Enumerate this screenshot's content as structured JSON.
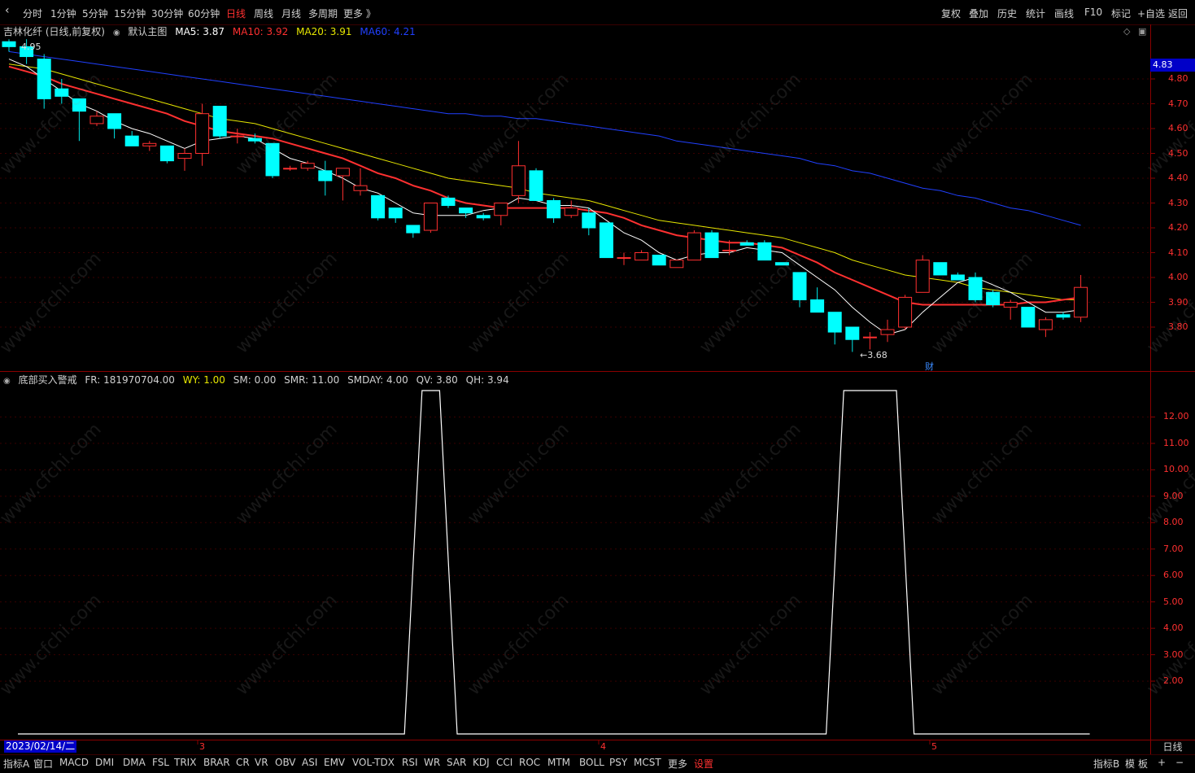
{
  "toolbar": {
    "back_arrow": "‹",
    "periods": [
      "分时",
      "1分钟",
      "5分钟",
      "15分钟",
      "30分钟",
      "60分钟",
      "日线",
      "周线",
      "月线",
      "多周期",
      "更多 》"
    ],
    "active_period": "日线",
    "right_items": [
      "复权",
      "叠加",
      "历史",
      "统计",
      "画线",
      "F10",
      "标记",
      "+自选",
      "返回"
    ]
  },
  "main_header": {
    "stock": "吉林化纤 (日线,前复权)",
    "template_icon": "dot-icon",
    "template": "默认主图",
    "ma5": "MA5: 3.87",
    "ma10": "MA10: 3.92",
    "ma20": "MA20: 3.91",
    "ma60": "MA60: 4.21",
    "colors": {
      "ma5": "#ffffff",
      "ma10": "#ff3030",
      "ma20": "#e6e600",
      "ma60": "#2040ff"
    }
  },
  "price_axis": {
    "labels": [
      "4.80",
      "4.70",
      "4.60",
      "4.50",
      "4.40",
      "4.30",
      "4.20",
      "4.10",
      "4.00",
      "3.90",
      "3.80"
    ],
    "current_price": "4.83"
  },
  "annotations": {
    "high": "4.95",
    "low": "←3.68",
    "fin_marker": "财"
  },
  "indicator_header": {
    "name": "底部买入警戒",
    "fr": "FR: 181970704.00",
    "wy": "WY: 1.00",
    "sm": "SM: 0.00",
    "smr": "SMR: 11.00",
    "smday": "SMDAY: 4.00",
    "qv": "QV: 3.80",
    "qh": "QH: 3.94"
  },
  "indicator_axis": {
    "labels": [
      "12.00",
      "11.00",
      "10.00",
      "9.00",
      "8.00",
      "7.00",
      "6.00",
      "5.00",
      "4.00",
      "3.00",
      "2.00"
    ]
  },
  "date_axis": {
    "current": "2023/02/14/二",
    "ticks": [
      "3",
      "4",
      "5"
    ],
    "period": "日线"
  },
  "bottom_tabs": [
    "指标A",
    "窗口",
    "MACD",
    "DMI",
    "DMA",
    "FSL",
    "TRIX",
    "BRAR",
    "CR",
    "VR",
    "OBV",
    "ASI",
    "EMV",
    "VOL-TDX",
    "RSI",
    "WR",
    "SAR",
    "KDJ",
    "CCI",
    "ROC",
    "MTM",
    "BOLL",
    "PSY",
    "MCST",
    "更多",
    "设置"
  ],
  "bottom_right": [
    "指标B",
    "模",
    "板",
    "+",
    "−"
  ],
  "watermark": "www.cfchi.com",
  "candles": [
    {
      "o": 4.95,
      "h": 4.96,
      "l": 4.91,
      "c": 4.93
    },
    {
      "o": 4.93,
      "h": 4.96,
      "l": 4.86,
      "c": 4.89
    },
    {
      "o": 4.88,
      "h": 4.9,
      "l": 4.68,
      "c": 4.72
    },
    {
      "o": 4.76,
      "h": 4.8,
      "l": 4.7,
      "c": 4.73
    },
    {
      "o": 4.72,
      "h": 4.72,
      "l": 4.55,
      "c": 4.67
    },
    {
      "o": 4.62,
      "h": 4.67,
      "l": 4.61,
      "c": 4.65
    },
    {
      "o": 4.66,
      "h": 4.66,
      "l": 4.56,
      "c": 4.6
    },
    {
      "o": 4.57,
      "h": 4.59,
      "l": 4.53,
      "c": 4.53
    },
    {
      "o": 4.53,
      "h": 4.55,
      "l": 4.51,
      "c": 4.54
    },
    {
      "o": 4.53,
      "h": 4.53,
      "l": 4.46,
      "c": 4.47
    },
    {
      "o": 4.48,
      "h": 4.52,
      "l": 4.43,
      "c": 4.5
    },
    {
      "o": 4.5,
      "h": 4.7,
      "l": 4.45,
      "c": 4.66
    },
    {
      "o": 4.69,
      "h": 4.69,
      "l": 4.56,
      "c": 4.57
    },
    {
      "o": 4.57,
      "h": 4.6,
      "l": 4.54,
      "c": 4.57
    },
    {
      "o": 4.56,
      "h": 4.58,
      "l": 4.54,
      "c": 4.55
    },
    {
      "o": 4.54,
      "h": 4.54,
      "l": 4.4,
      "c": 4.41
    },
    {
      "o": 4.44,
      "h": 4.45,
      "l": 4.43,
      "c": 4.44
    },
    {
      "o": 4.44,
      "h": 4.47,
      "l": 4.43,
      "c": 4.46
    },
    {
      "o": 4.43,
      "h": 4.47,
      "l": 4.33,
      "c": 4.39
    },
    {
      "o": 4.41,
      "h": 4.44,
      "l": 4.31,
      "c": 4.44
    },
    {
      "o": 4.35,
      "h": 4.44,
      "l": 4.33,
      "c": 4.37
    },
    {
      "o": 4.33,
      "h": 4.33,
      "l": 4.23,
      "c": 4.24
    },
    {
      "o": 4.28,
      "h": 4.28,
      "l": 4.22,
      "c": 4.24
    },
    {
      "o": 4.21,
      "h": 4.21,
      "l": 4.16,
      "c": 4.18
    },
    {
      "o": 4.19,
      "h": 4.3,
      "l": 4.18,
      "c": 4.3
    },
    {
      "o": 4.32,
      "h": 4.33,
      "l": 4.28,
      "c": 4.29
    },
    {
      "o": 4.28,
      "h": 4.28,
      "l": 4.24,
      "c": 4.26
    },
    {
      "o": 4.25,
      "h": 4.26,
      "l": 4.23,
      "c": 4.24
    },
    {
      "o": 4.25,
      "h": 4.3,
      "l": 4.21,
      "c": 4.3
    },
    {
      "o": 4.33,
      "h": 4.55,
      "l": 4.3,
      "c": 4.45
    },
    {
      "o": 4.43,
      "h": 4.44,
      "l": 4.31,
      "c": 4.31
    },
    {
      "o": 4.31,
      "h": 4.32,
      "l": 4.22,
      "c": 4.24
    },
    {
      "o": 4.25,
      "h": 4.31,
      "l": 4.24,
      "c": 4.28
    },
    {
      "o": 4.26,
      "h": 4.28,
      "l": 4.17,
      "c": 4.2
    },
    {
      "o": 4.22,
      "h": 4.22,
      "l": 4.08,
      "c": 4.08
    },
    {
      "o": 4.08,
      "h": 4.1,
      "l": 4.05,
      "c": 4.08
    },
    {
      "o": 4.07,
      "h": 4.11,
      "l": 4.07,
      "c": 4.1
    },
    {
      "o": 4.09,
      "h": 4.09,
      "l": 4.05,
      "c": 4.05
    },
    {
      "o": 4.04,
      "h": 4.07,
      "l": 4.04,
      "c": 4.07
    },
    {
      "o": 4.07,
      "h": 4.19,
      "l": 4.07,
      "c": 4.18
    },
    {
      "o": 4.18,
      "h": 4.19,
      "l": 4.08,
      "c": 4.08
    },
    {
      "o": 4.11,
      "h": 4.15,
      "l": 4.09,
      "c": 4.11
    },
    {
      "o": 4.14,
      "h": 4.15,
      "l": 4.13,
      "c": 4.13
    },
    {
      "o": 4.14,
      "h": 4.15,
      "l": 4.07,
      "c": 4.07
    },
    {
      "o": 4.06,
      "h": 4.06,
      "l": 4.05,
      "c": 4.05
    },
    {
      "o": 4.02,
      "h": 4.02,
      "l": 3.88,
      "c": 3.91
    },
    {
      "o": 3.91,
      "h": 3.96,
      "l": 3.86,
      "c": 3.86
    },
    {
      "o": 3.86,
      "h": 3.86,
      "l": 3.73,
      "c": 3.78
    },
    {
      "o": 3.8,
      "h": 3.8,
      "l": 3.7,
      "c": 3.75
    },
    {
      "o": 3.76,
      "h": 3.78,
      "l": 3.71,
      "c": 3.76
    },
    {
      "o": 3.77,
      "h": 3.83,
      "l": 3.74,
      "c": 3.79
    },
    {
      "o": 3.8,
      "h": 3.93,
      "l": 3.79,
      "c": 3.92
    },
    {
      "o": 3.94,
      "h": 4.09,
      "l": 3.94,
      "c": 4.07
    },
    {
      "o": 4.06,
      "h": 4.06,
      "l": 4.01,
      "c": 4.01
    },
    {
      "o": 4.01,
      "h": 4.02,
      "l": 3.99,
      "c": 3.99
    },
    {
      "o": 4.0,
      "h": 4.02,
      "l": 3.9,
      "c": 3.91
    },
    {
      "o": 3.94,
      "h": 3.95,
      "l": 3.88,
      "c": 3.89
    },
    {
      "o": 3.88,
      "h": 3.91,
      "l": 3.83,
      "c": 3.9
    },
    {
      "o": 3.88,
      "h": 3.88,
      "l": 3.8,
      "c": 3.8
    },
    {
      "o": 3.79,
      "h": 3.84,
      "l": 3.76,
      "c": 3.83
    },
    {
      "o": 3.85,
      "h": 3.86,
      "l": 3.83,
      "c": 3.84
    },
    {
      "o": 3.84,
      "h": 4.01,
      "l": 3.82,
      "c": 3.96
    }
  ],
  "ma_series": {
    "ma5": [
      4.88,
      4.85,
      4.8,
      4.75,
      4.7,
      4.67,
      4.63,
      4.6,
      4.58,
      4.55,
      4.52,
      4.55,
      4.56,
      4.57,
      4.56,
      4.52,
      4.48,
      4.46,
      4.43,
      4.4,
      4.36,
      4.34,
      4.3,
      4.26,
      4.25,
      4.25,
      4.25,
      4.27,
      4.28,
      4.32,
      4.31,
      4.29,
      4.29,
      4.28,
      4.23,
      4.18,
      4.15,
      4.1,
      4.07,
      4.09,
      4.1,
      4.1,
      4.12,
      4.11,
      4.1,
      4.05,
      4.0,
      3.95,
      3.88,
      3.82,
      3.77,
      3.79,
      3.86,
      3.92,
      3.98,
      4.0,
      3.97,
      3.94,
      3.9,
      3.86,
      3.86,
      3.87
    ],
    "ma10": [
      4.85,
      4.83,
      4.81,
      4.78,
      4.76,
      4.74,
      4.72,
      4.7,
      4.68,
      4.66,
      4.63,
      4.61,
      4.59,
      4.58,
      4.57,
      4.56,
      4.54,
      4.52,
      4.5,
      4.48,
      4.45,
      4.42,
      4.4,
      4.37,
      4.35,
      4.32,
      4.3,
      4.29,
      4.28,
      4.28,
      4.28,
      4.28,
      4.28,
      4.27,
      4.26,
      4.24,
      4.21,
      4.19,
      4.17,
      4.16,
      4.15,
      4.14,
      4.14,
      4.13,
      4.12,
      4.09,
      4.06,
      4.02,
      3.99,
      3.96,
      3.93,
      3.9,
      3.89,
      3.89,
      3.89,
      3.89,
      3.89,
      3.89,
      3.9,
      3.9,
      3.91,
      3.92
    ],
    "ma20": [
      4.86,
      4.85,
      4.84,
      4.82,
      4.8,
      4.78,
      4.76,
      4.74,
      4.72,
      4.7,
      4.68,
      4.66,
      4.64,
      4.63,
      4.62,
      4.6,
      4.58,
      4.56,
      4.54,
      4.52,
      4.5,
      4.48,
      4.46,
      4.44,
      4.42,
      4.4,
      4.39,
      4.38,
      4.37,
      4.36,
      4.34,
      4.33,
      4.32,
      4.31,
      4.29,
      4.27,
      4.25,
      4.23,
      4.22,
      4.21,
      4.2,
      4.19,
      4.18,
      4.17,
      4.16,
      4.14,
      4.12,
      4.1,
      4.07,
      4.05,
      4.03,
      4.01,
      4.0,
      3.99,
      3.98,
      3.96,
      3.95,
      3.94,
      3.93,
      3.92,
      3.91,
      3.91
    ],
    "ma60": [
      4.91,
      4.9,
      4.89,
      4.88,
      4.87,
      4.86,
      4.85,
      4.84,
      4.83,
      4.82,
      4.81,
      4.8,
      4.79,
      4.78,
      4.77,
      4.76,
      4.75,
      4.74,
      4.73,
      4.72,
      4.71,
      4.7,
      4.69,
      4.68,
      4.67,
      4.66,
      4.66,
      4.65,
      4.65,
      4.64,
      4.64,
      4.63,
      4.62,
      4.61,
      4.6,
      4.59,
      4.58,
      4.57,
      4.55,
      4.54,
      4.53,
      4.52,
      4.51,
      4.5,
      4.49,
      4.48,
      4.46,
      4.45,
      4.43,
      4.42,
      4.4,
      4.38,
      4.36,
      4.35,
      4.33,
      4.32,
      4.3,
      4.28,
      4.27,
      4.25,
      4.23,
      4.21
    ]
  },
  "indicator_series": [
    0,
    0,
    0,
    0,
    0,
    0,
    0,
    0,
    0,
    0,
    0,
    0,
    0,
    0,
    0,
    0,
    0,
    0,
    0,
    0,
    0,
    0,
    0,
    13,
    13,
    0,
    0,
    0,
    0,
    0,
    0,
    0,
    0,
    0,
    0,
    0,
    0,
    0,
    0,
    0,
    0,
    0,
    0,
    0,
    0,
    0,
    0,
    13,
    13,
    13,
    13,
    0,
    0,
    0,
    0,
    0,
    0,
    0,
    0,
    0,
    0,
    0
  ]
}
